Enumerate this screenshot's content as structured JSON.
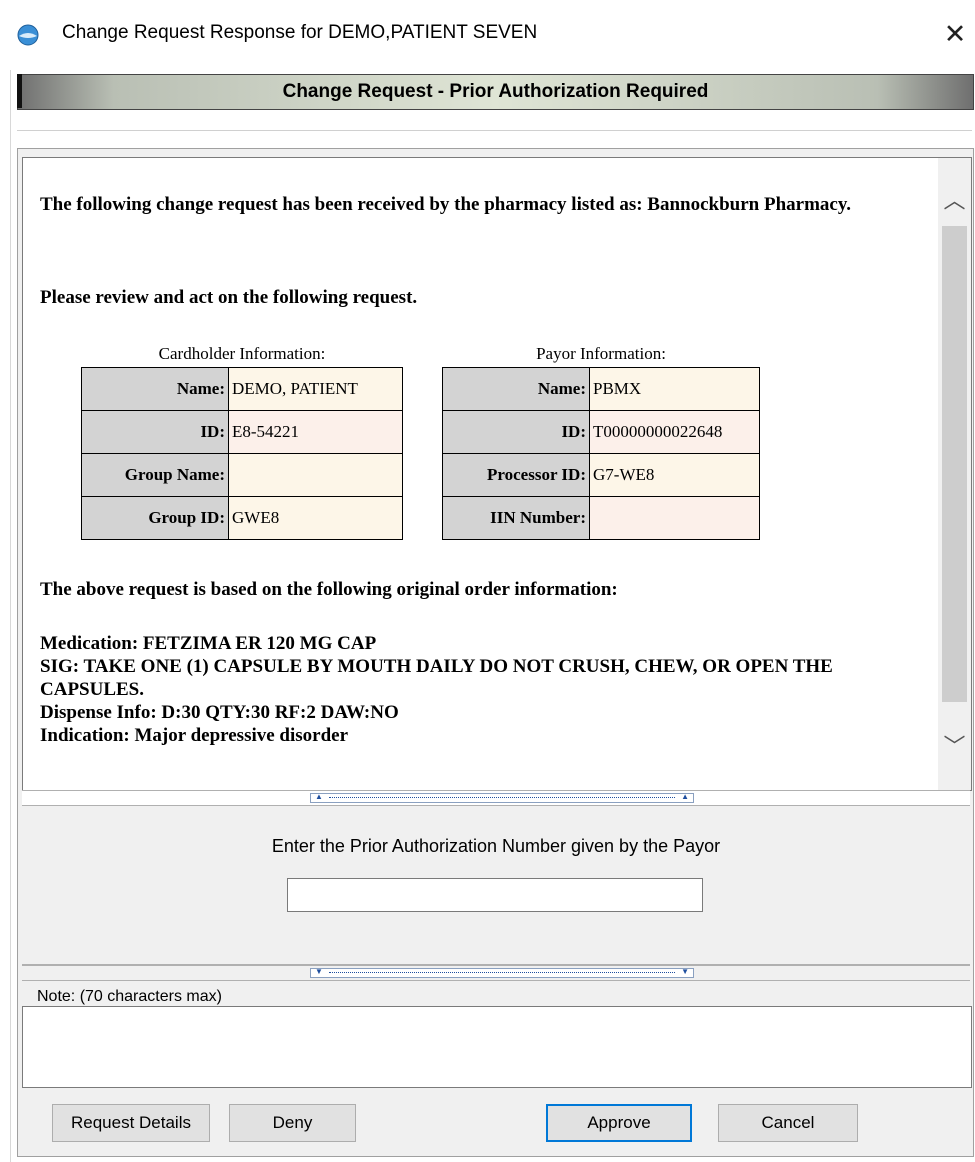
{
  "window": {
    "title": "Change Request Response for DEMO,PATIENT SEVEN",
    "close_glyph": "✕"
  },
  "banner": {
    "title": "Change Request - Prior Authorization Required"
  },
  "content": {
    "intro": "The following change request has been received by the pharmacy listed as: Bannockburn Pharmacy.",
    "review": "Please review and act on the following request.",
    "cardholder": {
      "caption": "Cardholder Information:",
      "rows": [
        {
          "label": "Name:",
          "value": "DEMO, PATIENT"
        },
        {
          "label": "ID:",
          "value": "E8-54221"
        },
        {
          "label": "Group Name:",
          "value": ""
        },
        {
          "label": "Group ID:",
          "value": "GWE8"
        }
      ]
    },
    "payor": {
      "caption": "Payor Information:",
      "rows": [
        {
          "label": "Name:",
          "value": "PBMX"
        },
        {
          "label": "ID:",
          "value": "T00000000022648"
        },
        {
          "label": "Processor ID:",
          "value": "G7-WE8"
        },
        {
          "label": "IIN Number:",
          "value": ""
        }
      ]
    },
    "original_order_heading": "The above request is based on the following original order information:",
    "medication": "Medication: FETZIMA ER 120 MG CAP",
    "sig": "SIG: TAKE ONE (1) CAPSULE BY MOUTH DAILY DO NOT CRUSH, CHEW, OR OPEN THE CAPSULES.",
    "dispense": "Dispense Info: D:30 QTY:30 RF:2 DAW:NO",
    "indication": "Indication: Major depressive disorder"
  },
  "scrollbar": {
    "up_glyph": "︿",
    "down_glyph": "﹀"
  },
  "prior_auth": {
    "label": "Enter the Prior Authorization Number given by the Payor",
    "value": ""
  },
  "note": {
    "legend": "Note: (70 characters max)",
    "value": ""
  },
  "buttons": {
    "request_details": "Request Details",
    "deny": "Deny",
    "approve": "Approve",
    "cancel": "Cancel"
  }
}
